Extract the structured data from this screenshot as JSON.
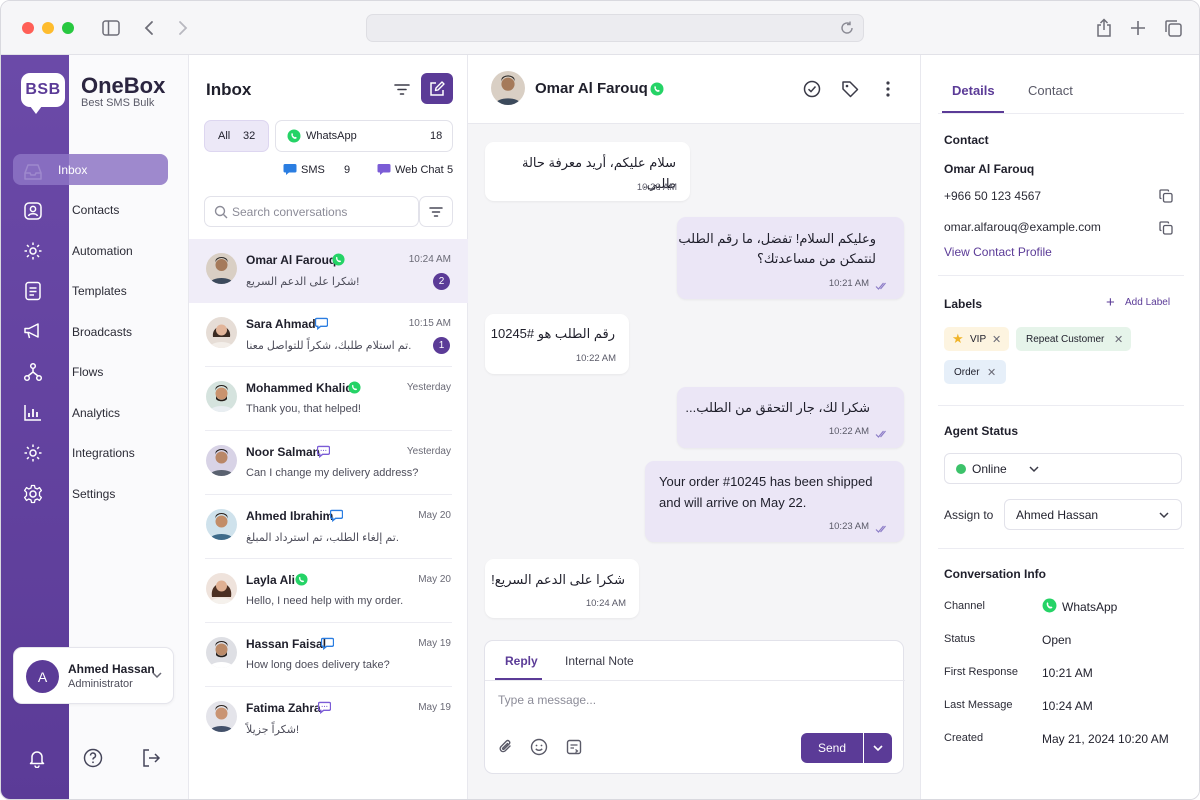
{
  "brand": {
    "logo": "BSB",
    "name": "OneBox",
    "subtitle": "Best SMS Bulk"
  },
  "colors": {
    "accent": "#5b3b97",
    "whatsapp": "#25d366",
    "sms": "#2a7de1",
    "webchat": "#7b5cd6"
  },
  "nav": {
    "items": [
      {
        "label": "Inbox",
        "icon": "inbox-icon",
        "active": true
      },
      {
        "label": "Contacts",
        "icon": "contacts-icon"
      },
      {
        "label": "Automation",
        "icon": "automation-icon"
      },
      {
        "label": "Templates",
        "icon": "templates-icon"
      },
      {
        "label": "Broadcasts",
        "icon": "megaphone-icon"
      },
      {
        "label": "Flows",
        "icon": "flows-icon"
      },
      {
        "label": "Analytics",
        "icon": "analytics-icon"
      },
      {
        "label": "Integrations",
        "icon": "integrations-icon"
      },
      {
        "label": "Settings",
        "icon": "gear-icon"
      }
    ]
  },
  "user": {
    "initial": "A",
    "name": "Ahmed Hassan",
    "role": "Administrator"
  },
  "inbox": {
    "title": "Inbox",
    "filters": {
      "all": {
        "label": "All",
        "count": "32"
      },
      "whatsapp": {
        "label": "WhatsApp",
        "count": "18"
      },
      "sms": {
        "label": "SMS",
        "count": "9"
      },
      "webchat": {
        "label": "Web Chat",
        "count": "5"
      }
    },
    "search_placeholder": "Search conversations",
    "conversations": [
      {
        "name": "Omar Al Farouq",
        "channel": "whatsapp",
        "time": "10:24 AM",
        "preview": "شكرا على الدعم السريع!",
        "unread": "2",
        "selected": true
      },
      {
        "name": "Sara Ahmad",
        "channel": "sms",
        "time": "10:15 AM",
        "preview": "تم استلام طلبك، شكراً للتواصل معنا.",
        "unread": "1"
      },
      {
        "name": "Mohammed Khalid",
        "channel": "whatsapp",
        "time": "Yesterday",
        "preview": "Thank you, that helped!"
      },
      {
        "name": "Noor Salman",
        "channel": "webchat",
        "time": "Yesterday",
        "preview": "Can I change my delivery address?"
      },
      {
        "name": "Ahmed Ibrahim",
        "channel": "sms",
        "time": "May 20",
        "preview": "تم إلغاء الطلب، تم استرداد المبلغ."
      },
      {
        "name": "Layla Ali",
        "channel": "whatsapp",
        "time": "May 20",
        "preview": "Hello, I need help with my order."
      },
      {
        "name": "Hassan Faisal",
        "channel": "sms",
        "time": "May 19",
        "preview": "How long does delivery take?"
      },
      {
        "name": "Fatima Zahra",
        "channel": "webchat",
        "time": "May 19",
        "preview": "شكراً جزيلاً!"
      }
    ]
  },
  "chat": {
    "contact_name": "Omar Al Farouq",
    "messages": [
      {
        "dir": "in",
        "lines": [
          "سلام عليكم، أريد معرفة حالة طلبي."
        ],
        "time": "10:20 AM"
      },
      {
        "dir": "out",
        "lines": [
          "وعليكم السلام! تفضل، ما رقم الطلب",
          "لنتمكن من مساعدتك؟"
        ],
        "time": "10:21 AM"
      },
      {
        "dir": "in",
        "lines": [
          "رقم الطلب هو #10245"
        ],
        "time": "10:22 AM"
      },
      {
        "dir": "out",
        "lines": [
          "شكرا لك، جار التحقق من الطلب..."
        ],
        "time": "10:22 AM"
      },
      {
        "dir": "out",
        "lines": [
          "Your order #10245 has been shipped",
          "and will arrive on May 22."
        ],
        "time": "10:23 AM"
      },
      {
        "dir": "in",
        "lines": [
          "شكرا على الدعم السريع!"
        ],
        "time": "10:24 AM"
      }
    ],
    "composer": {
      "tab_reply": "Reply",
      "tab_note": "Internal Note",
      "placeholder": "Type a message...",
      "send": "Send"
    }
  },
  "details": {
    "tabs": {
      "details": "Details",
      "contact": "Contact"
    },
    "contact": {
      "heading": "Contact",
      "name": "Omar Al Farouq",
      "phone": "+966 50 123 4567",
      "email": "omar.alfarouq@example.com",
      "profile_link": "View Contact Profile"
    },
    "labels": {
      "heading": "Labels",
      "add": "Add Label",
      "items": [
        {
          "text": "VIP",
          "icon": "star-icon"
        },
        {
          "text": "Repeat Customer"
        },
        {
          "text": "Order"
        }
      ]
    },
    "agent": {
      "heading": "Agent Status",
      "status": "Online",
      "assign_label": "Assign to",
      "assignee": "Ahmed Hassan"
    },
    "conversation_info": {
      "heading": "Conversation Info",
      "rows": [
        {
          "key": "Channel",
          "value": "WhatsApp"
        },
        {
          "key": "Status",
          "value": "Open"
        },
        {
          "key": "First Response",
          "value": "10:21 AM"
        },
        {
          "key": "Last Message",
          "value": "10:24 AM"
        },
        {
          "key": "Created",
          "value": "May 21, 2024 10:20 AM"
        }
      ]
    }
  }
}
